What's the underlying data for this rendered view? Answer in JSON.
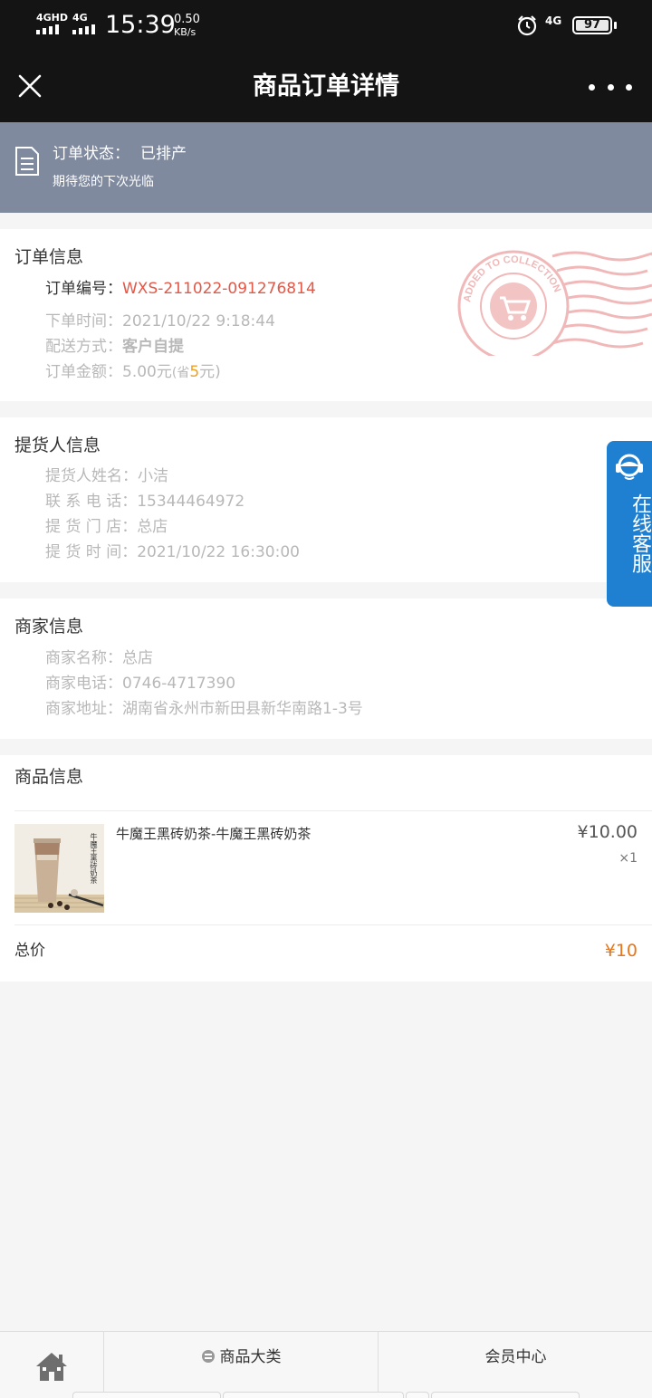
{
  "status_bar": {
    "network1": "4GHD",
    "network2": "4G",
    "time": "15:39",
    "speed_value": "0.50",
    "speed_unit": "KB/s",
    "network3": "4G",
    "battery": "97"
  },
  "navbar": {
    "title": "商品订单详情"
  },
  "order_status": {
    "label": "订单状态：",
    "value": "已排产",
    "subtitle": "期待您的下次光临"
  },
  "order_info": {
    "title": "订单信息",
    "order_no_label": "订单编号：",
    "order_no": "WXS-211022-091276814",
    "time_label": "下单时间：",
    "time": "2021/10/22 9:18:44",
    "delivery_label": "配送方式：",
    "delivery": "客户自提",
    "amount_label": "订单金额：",
    "amount": "5.00元",
    "save_prefix": "(省",
    "save_amount": "5",
    "save_suffix": "元)",
    "stamp_text": "ADDED TO COLLECTION"
  },
  "pickup_info": {
    "title": "提货人信息",
    "name_label": "提货人姓名：",
    "name": "小洁",
    "phone_label": "联 系 电 话：",
    "phone": "15344464972",
    "store_label": "提 货 门 店：",
    "store": "总店",
    "time_label": "提 货 时 间：",
    "time": "2021/10/22 16:30:00"
  },
  "merchant_info": {
    "title": "商家信息",
    "name_label": "商家名称：",
    "name": "总店",
    "phone_label": "商家电话：",
    "phone": "0746-4717390",
    "address_label": "商家地址：",
    "address": "湖南省永州市新田县新华南路1-3号"
  },
  "goods_info": {
    "title": "商品信息",
    "item": {
      "name": "牛魔王黑砖奶茶-牛魔王黑砖奶茶",
      "image_text": "牛魔王黑砖奶茶",
      "price": "¥10.00",
      "qty": "×1"
    },
    "total_label": "总价",
    "total_value": "¥10"
  },
  "customer_service": {
    "label": "在线客服"
  },
  "bottom_bar": {
    "category_label": "商品大类",
    "member_label": "会员中心"
  },
  "colors": {
    "accent_red": "#e15949",
    "price_orange": "#e8761b",
    "banner": "#7f8a9f",
    "service_blue": "#1f7fd0"
  },
  "icons": [
    "close-icon",
    "more-icon",
    "document-icon",
    "alarm-icon",
    "headset-icon",
    "home-icon",
    "category-icon"
  ]
}
